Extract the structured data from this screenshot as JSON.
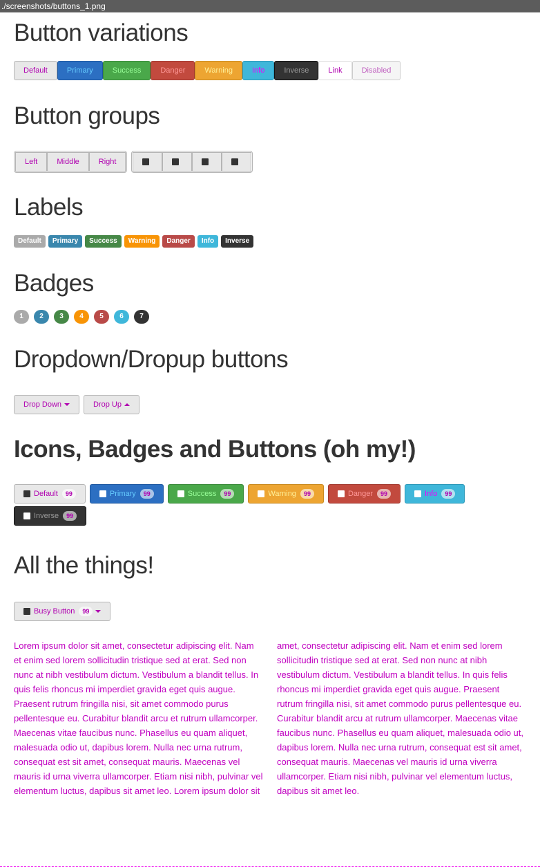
{
  "window": {
    "title": "./screenshots/buttons_1.png"
  },
  "sections": {
    "variations": "Button variations",
    "groups": "Button groups",
    "labels": "Labels",
    "badges": "Badges",
    "dropdowns": "Dropdown/Dropup buttons",
    "icons": "Icons, Badges and Buttons (oh my!)",
    "all": "All the things!"
  },
  "buttons": [
    {
      "label": "Default",
      "style": "default"
    },
    {
      "label": "Primary",
      "style": "primary"
    },
    {
      "label": "Success",
      "style": "success"
    },
    {
      "label": "Danger",
      "style": "danger"
    },
    {
      "label": "Warning",
      "style": "warning"
    },
    {
      "label": "Info",
      "style": "info"
    },
    {
      "label": "Inverse",
      "style": "inverse"
    },
    {
      "label": "Link",
      "style": "link"
    },
    {
      "label": "Disabled",
      "style": "disabled"
    }
  ],
  "groups": {
    "text": [
      "Left",
      "Middle",
      "Right"
    ],
    "icons": [
      "left-align-icon",
      "center-align-icon",
      "right-align-icon",
      "justify-icon"
    ]
  },
  "labels": [
    "Default",
    "Primary",
    "Success",
    "Warning",
    "Danger",
    "Info",
    "Inverse"
  ],
  "badges": [
    "1",
    "2",
    "3",
    "4",
    "5",
    "6",
    "7"
  ],
  "dropdowns": {
    "drop_down": "Drop Down",
    "drop_up": "Drop Up"
  },
  "icon_buttons": [
    {
      "label": "Default",
      "count": "99"
    },
    {
      "label": "Primary",
      "count": "99"
    },
    {
      "label": "Success",
      "count": "99"
    },
    {
      "label": "Warning",
      "count": "99"
    },
    {
      "label": "Danger",
      "count": "99"
    },
    {
      "label": "Info",
      "count": "99"
    },
    {
      "label": "Inverse",
      "count": "99"
    }
  ],
  "all_things": {
    "label": "Busy Button",
    "count": "99"
  },
  "paragraph": "Lorem ipsum dolor sit amet, consectetur adipiscing elit. Nam et enim sed lorem sollicitudin tristique sed at erat. Sed non nunc at nibh vestibulum dictum. Vestibulum a blandit tellus. In quis felis rhoncus mi imperdiet gravida eget quis augue. Praesent rutrum fringilla nisi, sit amet commodo purus pellentesque eu. Curabitur blandit arcu et rutrum ullamcorper. Maecenas vitae faucibus nunc. Phasellus eu quam aliquet, malesuada odio ut, dapibus lorem. Nulla nec urna rutrum, consequat est sit amet, consequat mauris. Maecenas vel mauris id urna viverra ullamcorper. Etiam nisi nibh, pulvinar vel elementum luctus, dapibus sit amet leo. Lorem ipsum dolor sit amet, consectetur adipiscing elit. Nam et enim sed lorem sollicitudin tristique sed at erat. Sed non nunc at nibh vestibulum dictum. Vestibulum a blandit tellus. In quis felis rhoncus mi imperdiet gravida eget quis augue. Praesent rutrum fringilla nisi, sit amet commodo purus pellentesque eu. Curabitur blandit arcu at rutrum ullamcorper. Maecenas vitae faucibus nunc. Phasellus eu quam aliquet, malesuada odio ut, dapibus lorem. Nulla nec urna rutrum, consequat est sit amet, consequat mauris. Maecenas vel mauris id urna viverra ullamcorper. Etiam nisi nibh, pulvinar vel elementum luctus, dapibus sit amet leo."
}
